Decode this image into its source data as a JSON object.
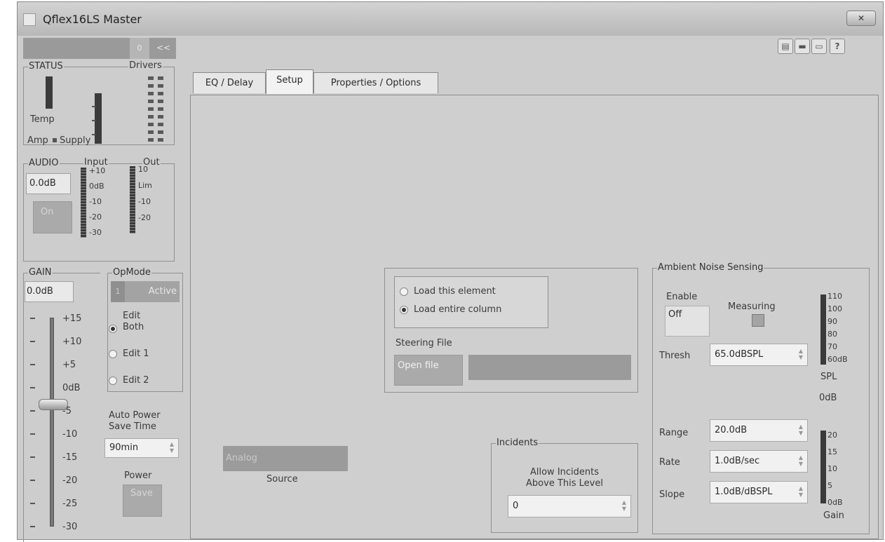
{
  "window": {
    "title": "Qflex16LS Master",
    "close_label": "✕"
  },
  "header": {
    "device_id": "0",
    "nav_arrows": "<<"
  },
  "status": {
    "legend": "STATUS",
    "drivers_label": "Drivers",
    "temp_label": "Temp",
    "amp_label": "Amp",
    "supply_label": "Supply"
  },
  "audio": {
    "legend": "AUDIO",
    "input_label": "Input",
    "out_label": "Out",
    "level_value": "0.0dB",
    "on_label": "On",
    "input_scale": [
      "+10",
      "0dB",
      "-10",
      "-20",
      "-30"
    ],
    "out_scale": [
      "10",
      "Lim",
      "-10",
      "-20"
    ]
  },
  "gain": {
    "legend": "GAIN",
    "value": "0.0dB",
    "scale": [
      "+15",
      "+10",
      "+5",
      "0dB",
      "-5",
      "-10",
      "-15",
      "-20",
      "-25",
      "-30"
    ]
  },
  "opmode": {
    "legend": "OpMode",
    "mode_id": "1",
    "mode_label": "Active",
    "edit_both_line1": "Edit",
    "edit_both_line2": "Both",
    "edit1": "Edit 1",
    "edit2": "Edit 2"
  },
  "autopower": {
    "label_line1": "Auto Power",
    "label_line2": "Save Time",
    "value": "90min",
    "power_label": "Power",
    "save_label": "Save"
  },
  "tabs": [
    {
      "label": "EQ / Delay"
    },
    {
      "label": "Setup"
    },
    {
      "label": "Properties / Options"
    }
  ],
  "steering": {
    "load_element": "Load this element",
    "load_column": "Load entire column",
    "file_label": "Steering File",
    "open_file": "Open file",
    "file_name": ""
  },
  "source": {
    "value": "Analog",
    "label": "Source"
  },
  "incidents": {
    "legend": "Incidents",
    "desc_line1": "Allow Incidents",
    "desc_line2": "Above This Level",
    "value": "0"
  },
  "ans": {
    "legend": "Ambient Noise Sensing",
    "enable_label": "Enable",
    "enable_value": "Off",
    "measuring_label": "Measuring",
    "thresh_label": "Thresh",
    "thresh_value": "65.0dBSPL",
    "spl_scale": [
      "110",
      "100",
      "90",
      "80",
      "70",
      "60dB"
    ],
    "spl_label": "SPL",
    "spl_value": "0dB",
    "range_label": "Range",
    "range_value": "20.0dB",
    "rate_label": "Rate",
    "rate_value": "1.0dB/sec",
    "slope_label": "Slope",
    "slope_value": "1.0dB/dBSPL",
    "gain_scale": [
      "20",
      "15",
      "10",
      "5",
      "0dB"
    ],
    "gain_label": "Gain"
  }
}
